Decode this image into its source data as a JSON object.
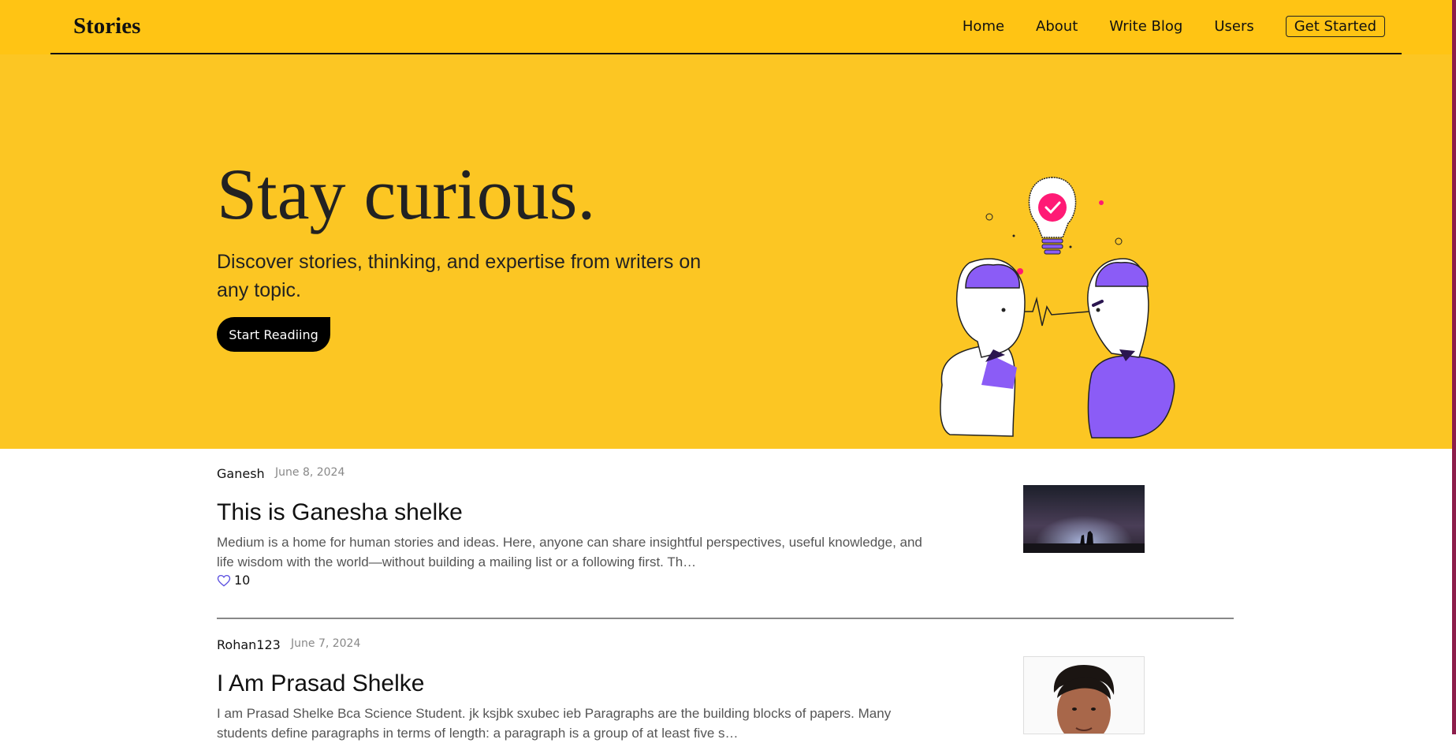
{
  "brand": "Stories",
  "nav": {
    "home": "Home",
    "about": "About",
    "write": "Write Blog",
    "users": "Users",
    "get_started": "Get Started"
  },
  "hero": {
    "title": "Stay curious.",
    "subtitle": "Discover stories, thinking, and expertise from writers on any topic.",
    "cta": "Start Readiing"
  },
  "posts": [
    {
      "author": "Ganesh",
      "date": "June 8, 2024",
      "title": "This is Ganesha shelke",
      "excerpt": "Medium is a home for human stories and ideas. Here, anyone can share insightful perspectives, useful knowledge, and life wisdom with the world—without building a mailing list or a following first. Th…",
      "likes": "10"
    },
    {
      "author": "Rohan123",
      "date": "June 7, 2024",
      "title": "I Am Prasad Shelke",
      "excerpt": "I am Prasad Shelke Bca Science Student. jk ksjbk sxubec ieb Paragraphs are the building blocks of papers. Many students define paragraphs in terms of length: a paragraph is a group of at least five s…"
    }
  ],
  "colors": {
    "header": "#ffc414",
    "hero": "#fcc623",
    "accent_purple": "#8b5cf6",
    "accent_pink": "#ff1a75"
  }
}
